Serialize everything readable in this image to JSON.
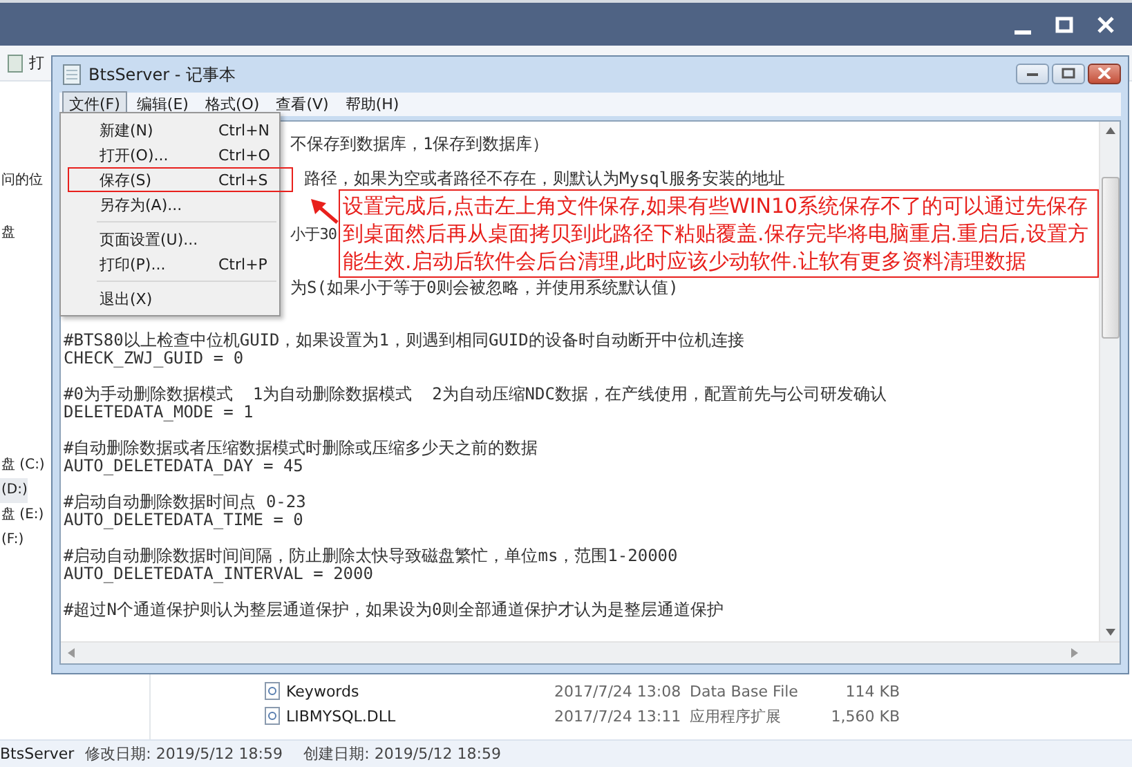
{
  "explorer": {
    "toolbar_button": "打",
    "nav_groups": [
      [
        {
          "label": "问的位",
          "selected": false
        },
        {
          "label": "盘",
          "selected": false
        }
      ],
      [
        {
          "label": "盘 (C:)",
          "selected": false
        },
        {
          "label": "(D:)",
          "selected": true
        },
        {
          "label": "盘 (E:)",
          "selected": false
        },
        {
          "label": "(F:)",
          "selected": false
        }
      ]
    ],
    "files": [
      {
        "name": "Keywords",
        "date": "2017/7/24 13:08",
        "type": "Data Base File",
        "size": "114 KB"
      },
      {
        "name": "LIBMYSQL.DLL",
        "date": "2017/7/24 13:11",
        "type": "应用程序扩展",
        "size": "1,560 KB"
      }
    ],
    "status_bar": {
      "name": "BtsServer",
      "modified": "修改日期: 2019/5/12 18:59",
      "created": "创建日期: 2019/5/12 18:59"
    }
  },
  "notepad": {
    "title": "BtsServer - 记事本",
    "menu": [
      {
        "label": "文件(F)",
        "selected": true
      },
      {
        "label": "编辑(E)",
        "selected": false
      },
      {
        "label": "格式(O)",
        "selected": false
      },
      {
        "label": "查看(V)",
        "selected": false
      },
      {
        "label": "帮助(H)",
        "selected": false
      }
    ],
    "file_menu": [
      {
        "kind": "item",
        "label": "新建(N)",
        "shortcut": "Ctrl+N",
        "marked": false
      },
      {
        "kind": "item",
        "label": "打开(O)...",
        "shortcut": "Ctrl+O",
        "marked": false
      },
      {
        "kind": "item",
        "label": "保存(S)",
        "shortcut": "Ctrl+S",
        "marked": true
      },
      {
        "kind": "item",
        "label": "另存为(A)...",
        "marked": false
      },
      {
        "kind": "separator"
      },
      {
        "kind": "item",
        "label": "页面设置(U)...",
        "marked": false
      },
      {
        "kind": "item",
        "label": "打印(P)...",
        "shortcut": "Ctrl+P",
        "marked": false
      },
      {
        "kind": "separator"
      },
      {
        "kind": "item",
        "label": "退出(X)",
        "marked": false
      }
    ],
    "partial_lines": [
      "不保存到数据库，1保存到数据库）",
      "路径，如果为空或者路径不存在，则默认为Mysql服务安装的地址",
      "小于30",
      "为S(如果小于等于0则会被忽略，并使用系统默认值)"
    ],
    "blocks": [
      [
        "#BTS80以上检查中位机GUID，如果设置为1，则遇到相同GUID的设备时自动断开中位机连接",
        "CHECK_ZWJ_GUID = 0"
      ],
      [
        "#0为手动删除数据模式  1为自动删除数据模式  2为自动压缩NDC数据，在产线使用，配置前先与公司研发确认",
        "DELETEDATA_MODE = 1"
      ],
      [
        "#自动删除数据或者压缩数据模式时删除或压缩多少天之前的数据",
        "AUTO_DELETEDATA_DAY = 45"
      ],
      [
        "#启动自动删除数据时间点 0-23",
        "AUTO_DELETEDATA_TIME = 0"
      ],
      [
        "#启动自动删除数据时间间隔，防止删除太快导致磁盘繁忙，单位ms，范围1-20000",
        "AUTO_DELETEDATA_INTERVAL = 2000"
      ],
      [
        "#超过N个通道保护则认为整层通道保护，如果设为0则全部通道保护才认为是整层通道保护"
      ]
    ]
  },
  "callout": {
    "text": "设置完成后,点击左上角文件保存,如果有些WIN10系统保存不了的可以通过先保存到桌面然后再从桌面拷贝到此路径下粘贴覆盖.保存完毕将电脑重启.重启后,设置方能生效.启动后软件会后台清理,此时应该少动软件.让软有更多资料清理数据"
  }
}
